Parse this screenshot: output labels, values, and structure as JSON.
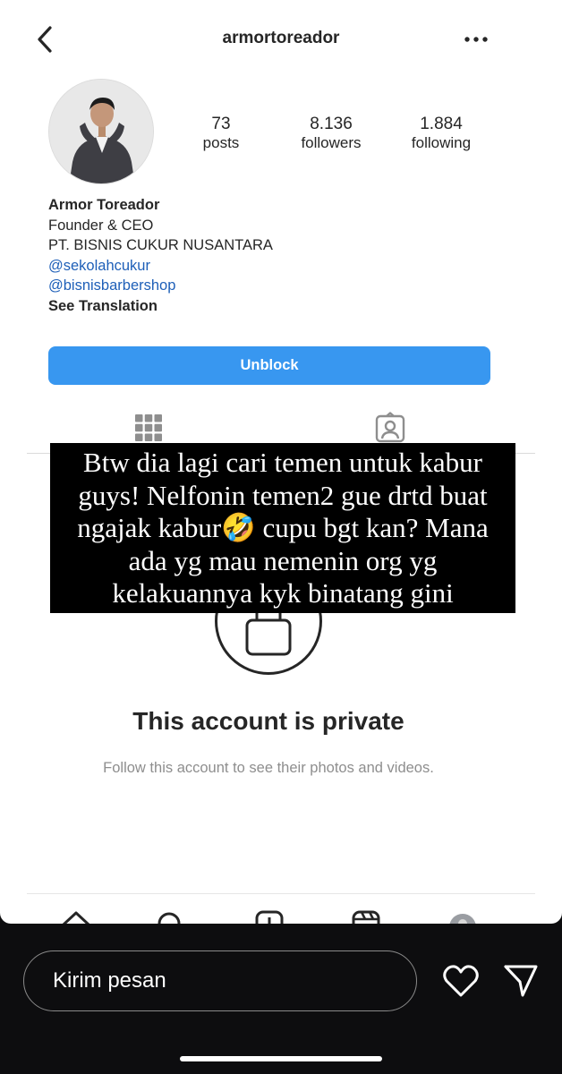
{
  "header": {
    "username": "armortoreador",
    "back_icon": "chevron-left-icon",
    "more_icon": "more-horizontal-icon"
  },
  "profile": {
    "avatar_icon": "profile-avatar",
    "stats": [
      {
        "value": "73",
        "label": "posts"
      },
      {
        "value": "8.136",
        "label": "followers"
      },
      {
        "value": "1.884",
        "label": "following"
      }
    ],
    "bio": {
      "name": "Armor Toreador",
      "title": "Founder & CEO",
      "company": "PT. BISNIS CUKUR NUSANTARA",
      "links": [
        "@sekolahcukur",
        "@bisnisbarbershop"
      ],
      "see_translation": "See Translation"
    },
    "unblock_label": "Unblock"
  },
  "tabs": {
    "grid_icon": "grid-icon",
    "tagged_icon": "tagged-person-icon"
  },
  "private": {
    "title": "This account is private",
    "subtitle": "Follow this account to see their photos and videos."
  },
  "caption": {
    "lines": [
      "Btw dia lagi cari temen untuk kabur",
      "guys! Nelfonin temen2 gue drtd buat",
      "ngajak kabur🤣 cupu bgt kan? Mana",
      "ada yg mau nemenin org yg",
      "kelakuannya kyk binatang gini"
    ]
  },
  "bottom_nav": {
    "icons": [
      "home-icon",
      "search-icon",
      "new-post-icon",
      "reels-icon",
      "profile-avatar-icon"
    ]
  },
  "reply": {
    "placeholder": "Kirim pesan",
    "like_icon": "heart-icon",
    "send_icon": "send-icon"
  },
  "colors": {
    "accent": "#3897f0",
    "link": "#1e5fb8",
    "overlay_bg": "#000000",
    "dark_bg": "#0d0d0f"
  }
}
